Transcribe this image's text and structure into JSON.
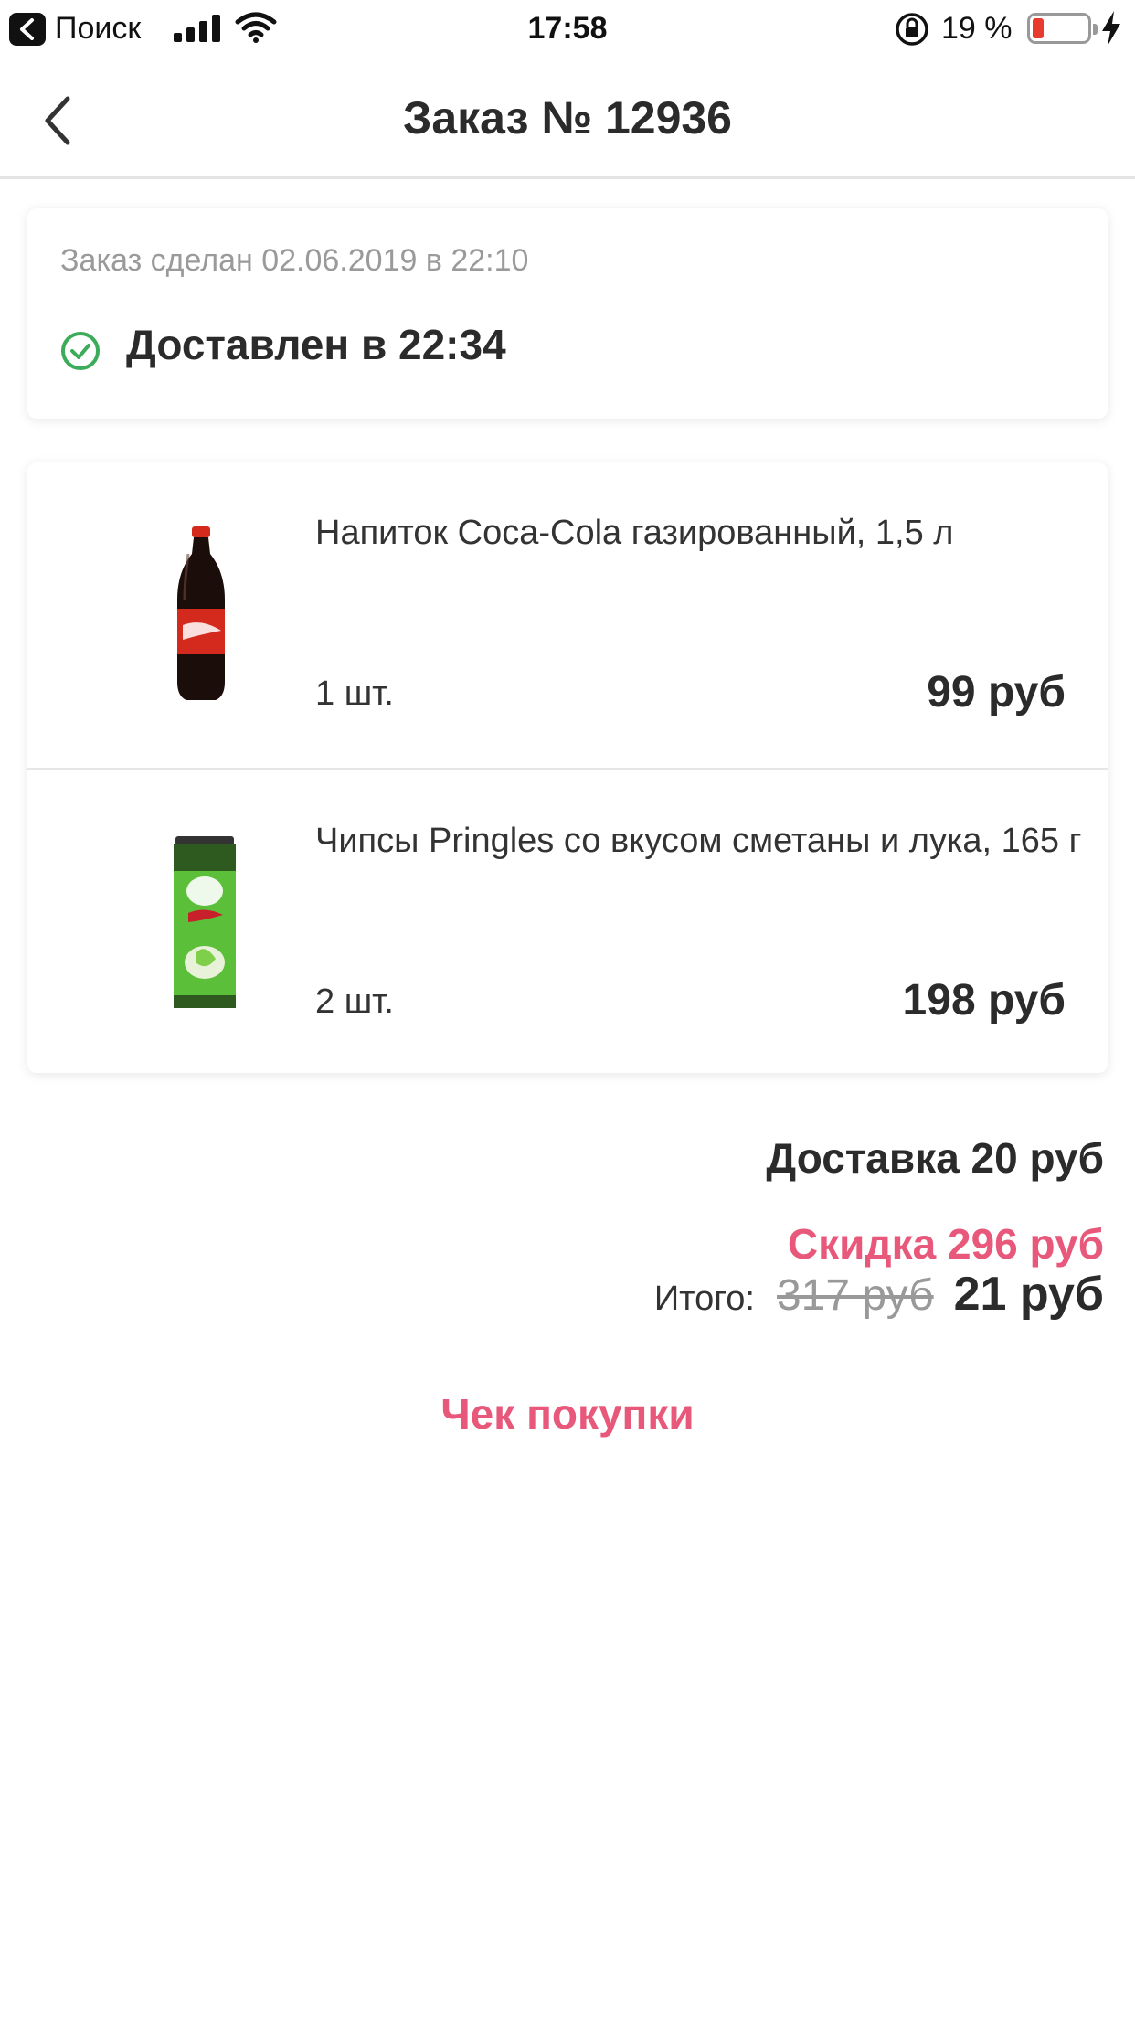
{
  "status_bar": {
    "back_app": "Поиск",
    "time": "17:58",
    "battery_percent": "19 %",
    "battery_level": 0.19,
    "battery_color": "#e63b2e"
  },
  "nav": {
    "back_icon": "chevron-left-icon",
    "title": "Заказ № 12936"
  },
  "order_status": {
    "placed": "Заказ сделан 02.06.2019 в 22:10",
    "status": "Доставлен в 22:34",
    "status_icon": "check-circle-icon",
    "status_color": "#3cab5a"
  },
  "items": [
    {
      "name": "Напиток Coca-Cola газированный, 1,5 л",
      "quantity": "1 шт.",
      "price": "99 руб",
      "image": "coca-cola-bottle-image"
    },
    {
      "name": "Чипсы Pringles со вкусом сметаны и лука, 165 г",
      "quantity": "2 шт.",
      "price": "198 руб",
      "image": "pringles-can-image"
    }
  ],
  "totals": {
    "delivery": "Доставка 20 руб",
    "discount": "Скидка 296 руб",
    "total_label": "Итого:",
    "total_old": "317 руб",
    "total_new": "21 руб"
  },
  "receipt_link": "Чек покупки",
  "accent_color": "#e8587a"
}
